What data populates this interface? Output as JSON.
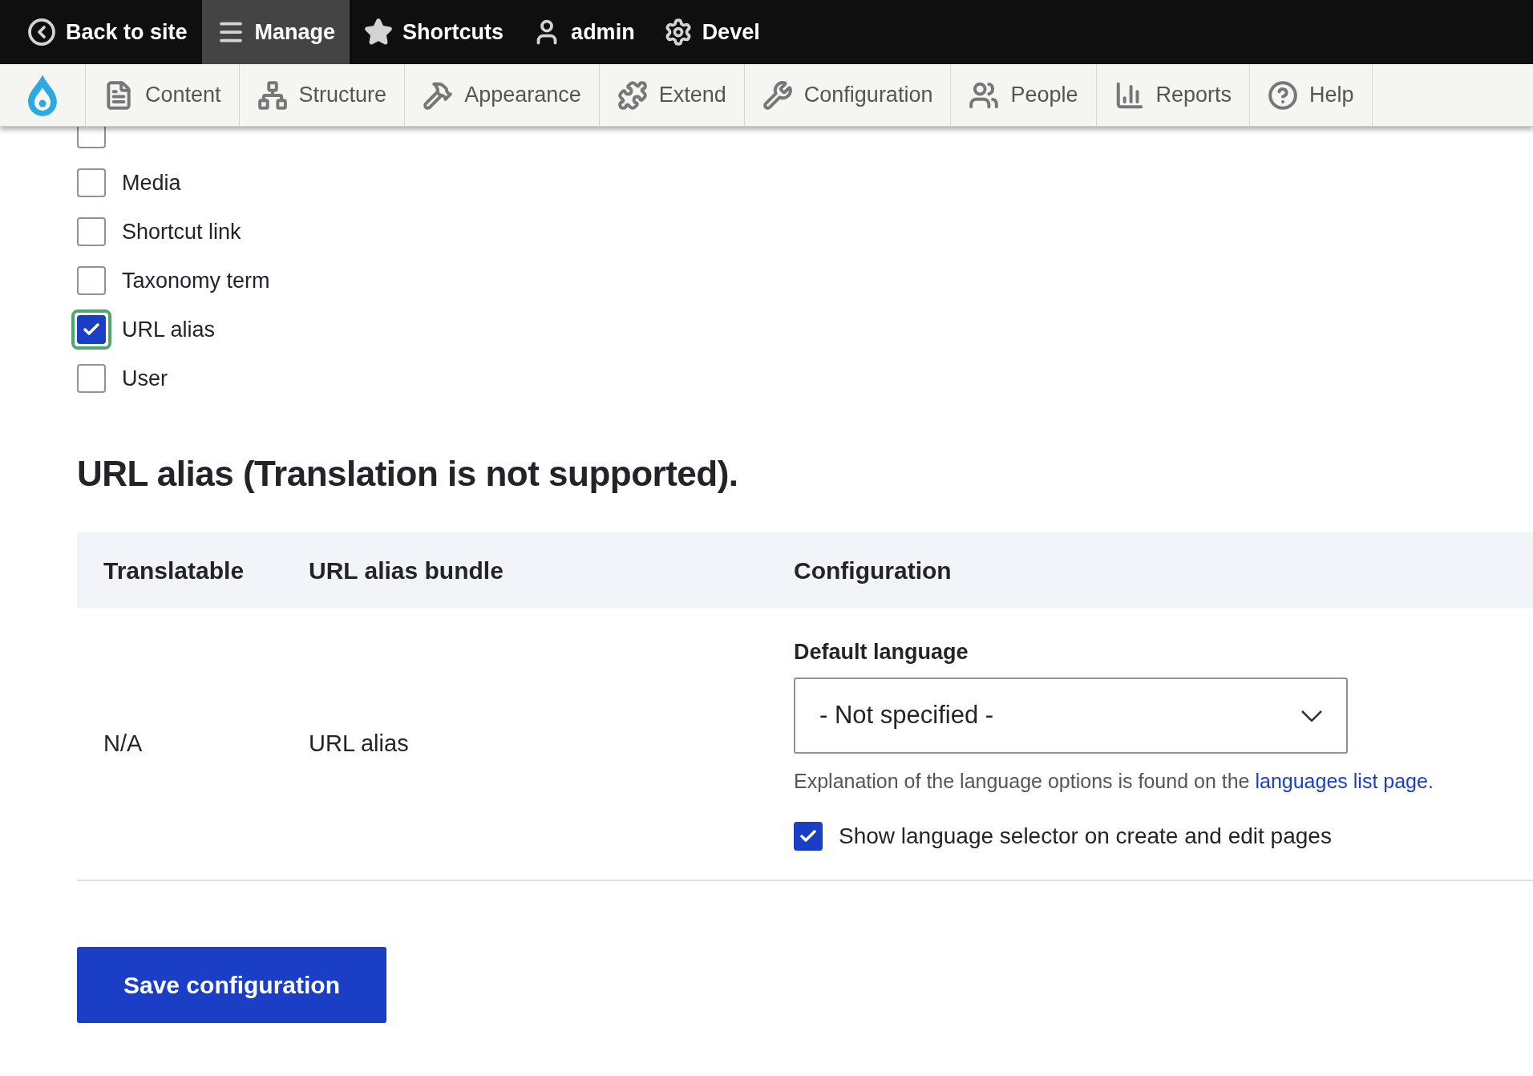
{
  "toolbar": {
    "items": [
      {
        "label": "Back to site",
        "selected": false
      },
      {
        "label": "Manage",
        "selected": true
      },
      {
        "label": "Shortcuts",
        "selected": false
      },
      {
        "label": "admin",
        "selected": false
      },
      {
        "label": "Devel",
        "selected": false
      }
    ]
  },
  "tray": {
    "items": [
      {
        "label": "Content"
      },
      {
        "label": "Structure"
      },
      {
        "label": "Appearance"
      },
      {
        "label": "Extend"
      },
      {
        "label": "Configuration"
      },
      {
        "label": "People"
      },
      {
        "label": "Reports"
      },
      {
        "label": "Help"
      }
    ]
  },
  "entity_types": [
    {
      "checked": false,
      "focused": false
    },
    {
      "label": "Media",
      "checked": false,
      "focused": false
    },
    {
      "label": "Shortcut link",
      "checked": false,
      "focused": false
    },
    {
      "label": "Taxonomy term",
      "checked": false,
      "focused": false
    },
    {
      "label": "URL alias",
      "checked": true,
      "focused": true
    },
    {
      "label": "User",
      "checked": false,
      "focused": false
    }
  ],
  "heading": "URL alias (Translation is not supported).",
  "table": {
    "columns": [
      "Translatable",
      "URL alias bundle",
      "Configuration"
    ],
    "rows": [
      {
        "translatable": "N/A",
        "bundle": "URL alias",
        "default_language": {
          "label": "Default language",
          "value": "- Not specified -"
        },
        "description": "Explanation of the language options is found on the ",
        "link": "languages list page",
        "description_end": ".",
        "show_selector": {
          "label": "Show language selector on create and edit pages",
          "checked": true
        }
      }
    ]
  },
  "save_button": "Save configuration"
}
